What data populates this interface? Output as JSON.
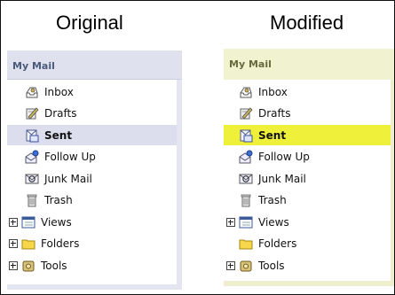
{
  "headings": {
    "original": "Original",
    "modified": "Modified"
  },
  "original": {
    "title": "My Mail",
    "items": [
      {
        "label": "Inbox",
        "icon": "inbox-icon",
        "expandable": false,
        "selected": false
      },
      {
        "label": "Drafts",
        "icon": "drafts-icon",
        "expandable": false,
        "selected": false
      },
      {
        "label": "Sent",
        "icon": "sent-icon",
        "expandable": false,
        "selected": true
      },
      {
        "label": "Follow Up",
        "icon": "follow-up-icon",
        "expandable": false,
        "selected": false
      },
      {
        "label": "Junk Mail",
        "icon": "junk-mail-icon",
        "expandable": false,
        "selected": false
      },
      {
        "label": "Trash",
        "icon": "trash-icon",
        "expandable": false,
        "selected": false
      },
      {
        "label": "Views",
        "icon": "views-icon",
        "expandable": true,
        "selected": false
      },
      {
        "label": "Folders",
        "icon": "folder-icon",
        "expandable": true,
        "selected": false
      },
      {
        "label": "Tools",
        "icon": "tools-icon",
        "expandable": true,
        "selected": false
      }
    ]
  },
  "modified": {
    "title": "My Mail",
    "items": [
      {
        "label": "Inbox",
        "icon": "inbox-icon",
        "expandable": false,
        "selected": false
      },
      {
        "label": "Drafts",
        "icon": "drafts-icon",
        "expandable": false,
        "selected": false
      },
      {
        "label": "Sent",
        "icon": "sent-icon",
        "expandable": false,
        "selected": true
      },
      {
        "label": "Follow Up",
        "icon": "follow-up-icon",
        "expandable": false,
        "selected": false
      },
      {
        "label": "Junk Mail",
        "icon": "junk-mail-icon",
        "expandable": false,
        "selected": false
      },
      {
        "label": "Trash",
        "icon": "trash-icon",
        "expandable": false,
        "selected": false
      },
      {
        "label": "Views",
        "icon": "views-icon",
        "expandable": true,
        "selected": false
      },
      {
        "label": "Folders",
        "icon": "folder-icon",
        "expandable": false,
        "selected": false
      },
      {
        "label": "Tools",
        "icon": "tools-icon",
        "expandable": true,
        "selected": false
      }
    ]
  },
  "colors": {
    "original_selected_bg": "#dcdeee",
    "modified_selected_bg": "#eef03a",
    "original_header_bg": "#dfe2ee",
    "modified_header_bg": "#f1f2cf"
  }
}
